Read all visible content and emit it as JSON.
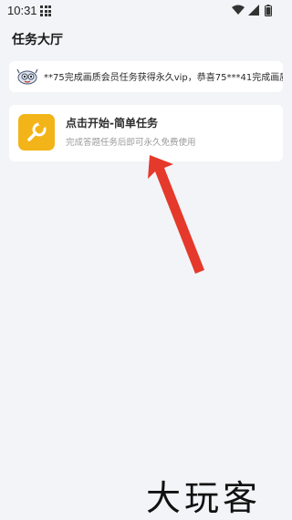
{
  "status_bar": {
    "time": "10:31",
    "icons": [
      "grid-icon",
      "wifi-icon",
      "signal-icon",
      "battery-icon"
    ]
  },
  "header": {
    "title": "任务大厅"
  },
  "notice": {
    "icon": "broadcast-avatar-icon",
    "text": "**75完成画质会员任务获得永久vip，恭喜75***41完成画质"
  },
  "task": {
    "icon": "wrench-icon",
    "title": "点击开始-简单任务",
    "description": "完成答题任务后即可永久免费使用",
    "icon_color": "#f3b419"
  },
  "annotation": {
    "type": "red-arrow",
    "color": "#e5392b"
  },
  "watermark": {
    "text": "大玩客"
  }
}
